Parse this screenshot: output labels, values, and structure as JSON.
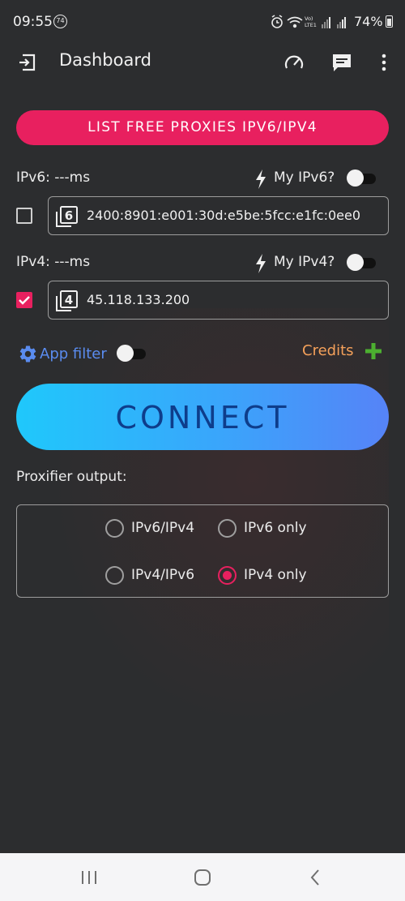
{
  "status_bar": {
    "time": "09:55",
    "notification_badge": "74",
    "battery_percent": "74%"
  },
  "app_bar": {
    "title": "Dashboard",
    "icons": [
      "logout-icon",
      "speedometer-icon",
      "chat-icon",
      "more-vert-icon"
    ]
  },
  "list_button": {
    "label": "LIST FREE PROXIES IPV6/IPV4"
  },
  "ipv6": {
    "label": "IPv6: ---ms",
    "my_ip_label": "My IPv6?",
    "my_ip_toggle_on": false,
    "checked": false,
    "field_badge": "6",
    "address": "2400:8901:e001:30d:e5be:5fcc:e1fc:0ee0"
  },
  "ipv4": {
    "label": "IPv4: ---ms",
    "my_ip_label": "My IPv4?",
    "my_ip_toggle_on": false,
    "checked": true,
    "field_badge": "4",
    "address": "45.118.133.200"
  },
  "app_filter": {
    "label": "App filter",
    "toggle_on": false
  },
  "credits": {
    "label": "Credits"
  },
  "connect": {
    "label": "CONNECT"
  },
  "proxifier": {
    "label": "Proxifier output:",
    "options": [
      {
        "label": "IPv6/IPv4",
        "selected": false
      },
      {
        "label": "IPv6 only",
        "selected": false
      },
      {
        "label": "IPv4/IPv6",
        "selected": false
      },
      {
        "label": "IPv4 only",
        "selected": true
      }
    ]
  },
  "colors": {
    "background": "#2c2d2f",
    "accent_pink": "#e8205f",
    "credits_orange": "#f5a15a",
    "app_filter_blue": "#5a8cf0",
    "plus_green": "#4caf30",
    "connect_gradient": [
      "#1fc8fb",
      "#5683f7"
    ],
    "connect_text": "#0e3d8b"
  }
}
